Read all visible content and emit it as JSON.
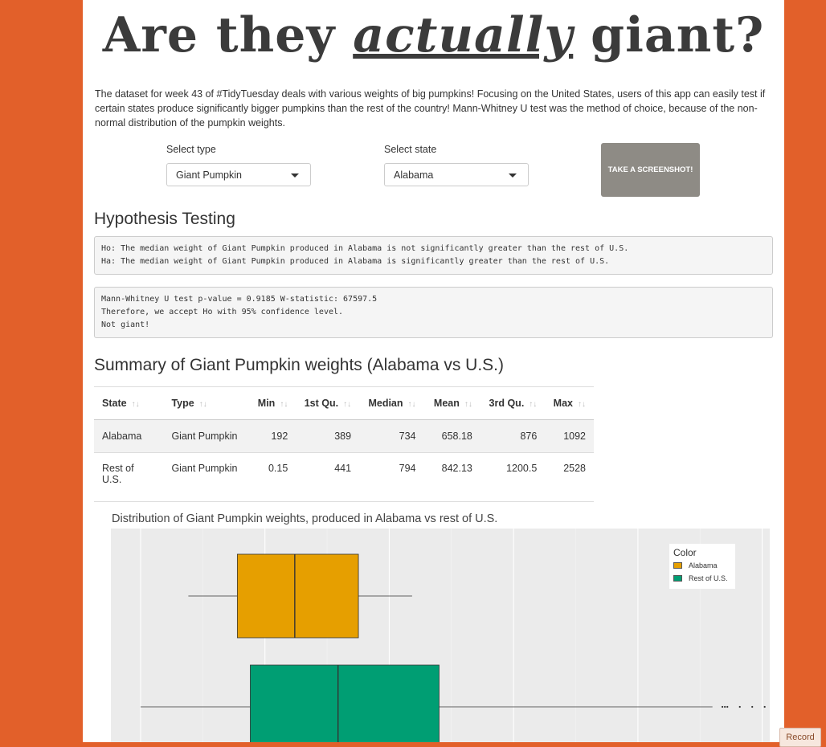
{
  "title": {
    "part1": "Are they",
    "part2": "actually",
    "part3": "giant?"
  },
  "intro": "The dataset for week 43 of #TidyTuesday deals with various weights of big pumpkins! Focusing on the United States, users of this app can easily test if certain states produce significantly bigger pumpkins than the rest of the country! Mann-Whitney U test was the method of choice, because of the non-normal distribution of the pumpkin weights.",
  "controls": {
    "type_label": "Select type",
    "type_value": "Giant Pumpkin",
    "state_label": "Select state",
    "state_value": "Alabama",
    "screenshot_label": "TAKE A SCREENSHOT!"
  },
  "hypothesis": {
    "heading": "Hypothesis Testing",
    "h0": "Ho: The median weight of Giant Pumpkin produced in Alabama is not significantly greater than the rest of U.S.",
    "ha": "Ha: The median weight of Giant Pumpkin produced in Alabama is significantly greater than the rest of U.S.",
    "result1": "Mann-Whitney U test p-value = 0.9185 W-statistic: 67597.5",
    "result2": "Therefore, we accept Ho with 95% confidence level.",
    "result3": "Not giant!"
  },
  "summary": {
    "heading": "Summary of Giant Pumpkin weights (Alabama vs U.S.)",
    "columns": [
      "State",
      "Type",
      "Min",
      "1st Qu.",
      "Median",
      "Mean",
      "3rd Qu.",
      "Max"
    ],
    "rows": [
      [
        "Alabama",
        "Giant Pumpkin",
        "192",
        "389",
        "734",
        "658.18",
        "876",
        "1092"
      ],
      [
        "Rest of U.S.",
        "Giant Pumpkin",
        "0.15",
        "441",
        "794",
        "842.13",
        "1200.5",
        "2528"
      ]
    ]
  },
  "plot": {
    "title": "Distribution of Giant Pumpkin weights, produced in Alabama vs rest of U.S.",
    "legend_title": "Color",
    "legend_items": [
      "Alabama",
      "Rest of U.S."
    ]
  },
  "chart_data": {
    "type": "boxplot",
    "title": "Distribution of Giant Pumpkin weights, produced in Alabama vs rest of U.S.",
    "orientation": "horizontal",
    "xlim": [
      0,
      2650
    ],
    "grid": true,
    "legend_title": "Color",
    "legend_position": "top-right",
    "series": [
      {
        "name": "Alabama",
        "color": "#e69f00",
        "whisker_low": 192,
        "q1": 389,
        "median": 620,
        "q3": 876,
        "whisker_high": 1092,
        "outliers": []
      },
      {
        "name": "Rest of U.S.",
        "color": "#009e73",
        "whisker_low": 0.15,
        "q1": 441,
        "median": 794,
        "q3": 1200.5,
        "whisker_high": 2300,
        "outliers": [
          2340,
          2350,
          2360,
          2410,
          2460,
          2510
        ]
      }
    ]
  },
  "footer": {
    "record_label": "Record"
  }
}
